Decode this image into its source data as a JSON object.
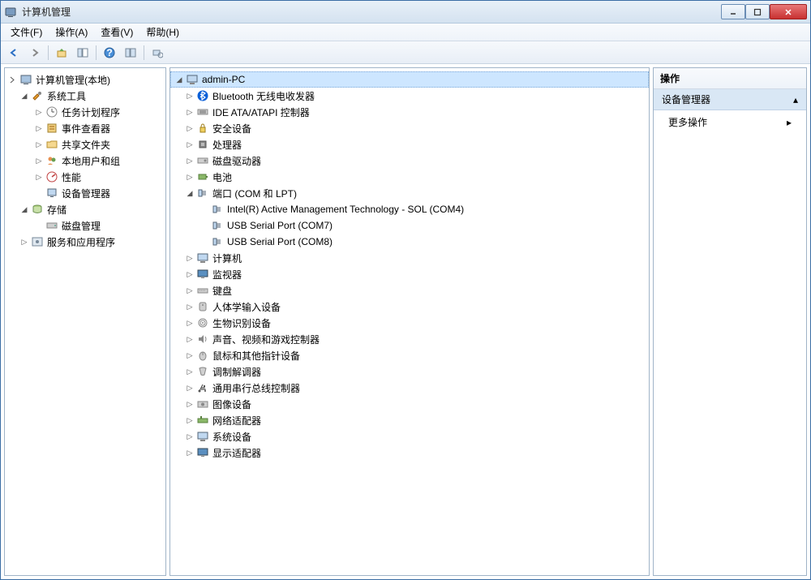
{
  "window": {
    "title": "计算机管理"
  },
  "menu": {
    "file": "文件(F)",
    "action": "操作(A)",
    "view": "查看(V)",
    "help": "帮助(H)"
  },
  "left_tree": {
    "root": "计算机管理(本地)",
    "system_tools": "系统工具",
    "task_scheduler": "任务计划程序",
    "event_viewer": "事件查看器",
    "shared_folders": "共享文件夹",
    "local_users": "本地用户和组",
    "performance": "性能",
    "device_manager": "设备管理器",
    "storage": "存储",
    "disk_management": "磁盘管理",
    "services_apps": "服务和应用程序"
  },
  "center_tree": {
    "computer": "admin-PC",
    "bluetooth": "Bluetooth 无线电收发器",
    "ide": "IDE ATA/ATAPI 控制器",
    "security": "安全设备",
    "processors": "处理器",
    "disk_drives": "磁盘驱动器",
    "battery": "电池",
    "ports": "端口 (COM 和 LPT)",
    "port_sol": "Intel(R) Active Management Technology - SOL (COM4)",
    "port_com7": "USB Serial Port (COM7)",
    "port_com8": "USB Serial Port (COM8)",
    "computers": "计算机",
    "monitors": "监视器",
    "keyboards": "键盘",
    "hid": "人体学输入设备",
    "biometric": "生物识别设备",
    "sound": "声音、视频和游戏控制器",
    "mice": "鼠标和其他指针设备",
    "modems": "调制解调器",
    "usb_controllers": "通用串行总线控制器",
    "imaging": "图像设备",
    "network": "网络适配器",
    "system_devices": "系统设备",
    "display": "显示适配器"
  },
  "right_panel": {
    "header": "操作",
    "section": "设备管理器",
    "more_actions": "更多操作"
  },
  "colors": {
    "bluetooth": "#0a5fd8",
    "selected_bg": "#cde6ff"
  }
}
